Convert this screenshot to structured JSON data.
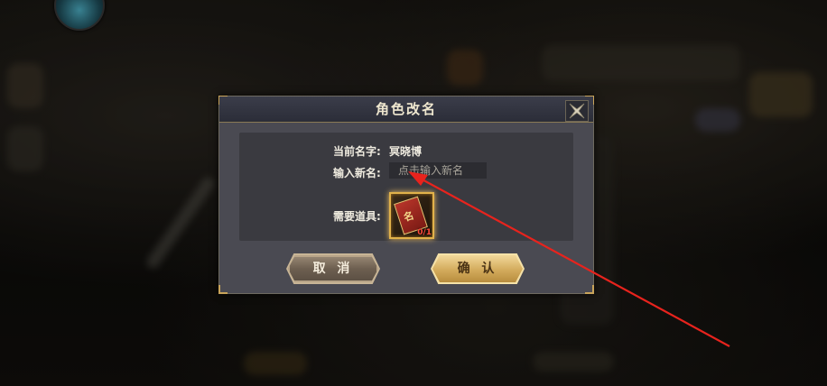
{
  "dialog": {
    "title": "角色改名",
    "current_name_label": "当前名字:",
    "current_name_value": "冥晓博",
    "new_name_label": "输入新名:",
    "new_name_placeholder": "点击输入新名",
    "required_item_label": "需要道具:",
    "item": {
      "icon": "rename-card-icon",
      "count_text": "0/1"
    },
    "cancel_label": "取 消",
    "confirm_label": "确 认"
  },
  "colors": {
    "dialog_bg": "#4a4a52",
    "gold_accent": "#e2b24a",
    "annotation_arrow": "#e8231d"
  }
}
